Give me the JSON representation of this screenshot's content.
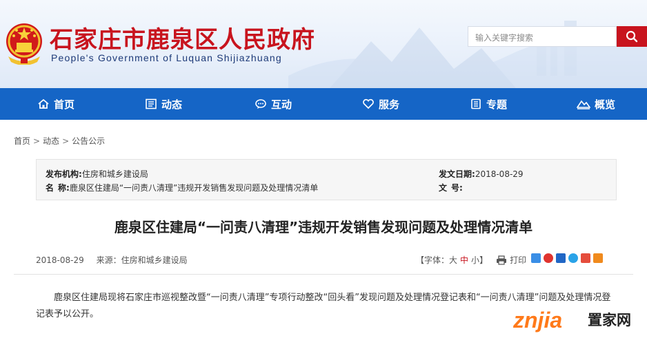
{
  "header": {
    "title": "石家庄市鹿泉区人民政府",
    "subtitle": "People's Government of Luquan Shijiazhuang",
    "search_placeholder": "输入关键字搜索",
    "brand_color": "#c8141e"
  },
  "nav": {
    "color": "#1565c6",
    "items": [
      {
        "label": "首页",
        "icon": "home-icon"
      },
      {
        "label": "动态",
        "icon": "news-icon"
      },
      {
        "label": "互动",
        "icon": "chat-icon"
      },
      {
        "label": "服务",
        "icon": "heart-icon"
      },
      {
        "label": "专题",
        "icon": "topic-icon"
      },
      {
        "label": "概览",
        "icon": "mountain-icon"
      }
    ]
  },
  "breadcrumb": [
    "首页",
    "动态",
    "公告公示"
  ],
  "info": {
    "publisher_label": "发布机构:",
    "publisher": "住房和城乡建设局",
    "date_label": "发文日期:",
    "date": "2018-08-29",
    "name_label": "名    称:",
    "name": "鹿泉区住建局“一问责八清理”违规开发销售发现问题及处理情况清单",
    "number_label": "文    号:",
    "number": ""
  },
  "article": {
    "title": "鹿泉区住建局“一问责八清理”违规开发销售发现问题及处理情况清单",
    "date": "2018-08-29",
    "source": "来源：住房和城乡建设局",
    "font_label_prefix": "【字体：",
    "font_large": "大",
    "font_medium": "中",
    "font_small": "小",
    "font_label_suffix": "】",
    "print_label": "打印",
    "body": "鹿泉区住建局现将石家庄市巡视整改暨“一问责八清理”专项行动整改“回头看”发现问题及处理情况登记表和“一问责八清理”问题及处理情况登记表予以公开。"
  },
  "watermark": {
    "logo": "znjia",
    "text": "置家网"
  }
}
